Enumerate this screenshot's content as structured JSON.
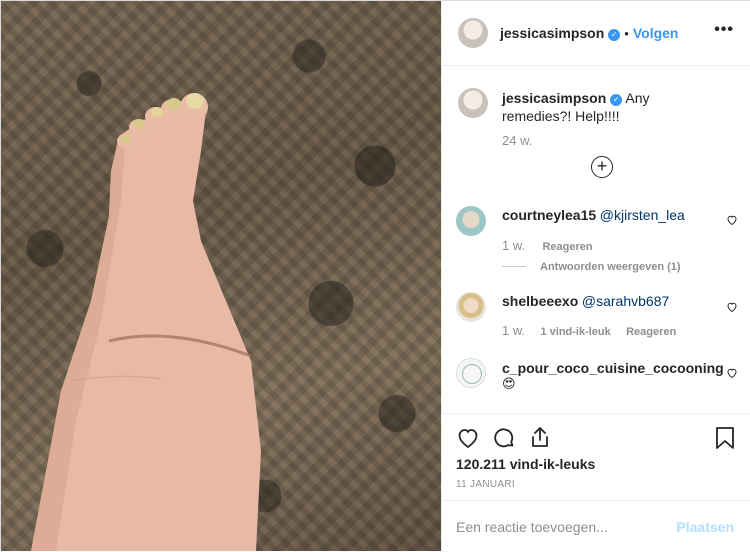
{
  "header": {
    "username": "jessicasimpson",
    "separator": "•",
    "follow_label": "Volgen",
    "more_icon": "more-horizontal-icon"
  },
  "caption": {
    "username": "jessicasimpson",
    "text": "Any remedies?! Help!!!!",
    "timestamp": "24 w."
  },
  "load_more_icon": "plus-circle-icon",
  "comments": [
    {
      "username": "courtneylea15",
      "mention": "@kjirsten_lea",
      "time": "1 w.",
      "likes": "",
      "reply_label": "Reageren",
      "view_replies": "Antwoorden weergeven (1)"
    },
    {
      "username": "shelbeeexo",
      "mention": "@sarahvb687",
      "time": "1 w.",
      "likes": "1 vind-ik-leuk",
      "reply_label": "Reageren"
    },
    {
      "username": "c_pour_coco_cuisine_cocooning",
      "mention": "",
      "emoji": "😍"
    }
  ],
  "actions": {
    "likes_count": "120.211 vind-ik-leuks",
    "date": "11 JANUARI"
  },
  "add_comment": {
    "placeholder": "Een reactie toevoegen...",
    "post_label": "Plaatsen"
  },
  "colors": {
    "accent": "#3897f0",
    "post_disabled": "#b2dffc",
    "muted": "#8e8e8e"
  }
}
